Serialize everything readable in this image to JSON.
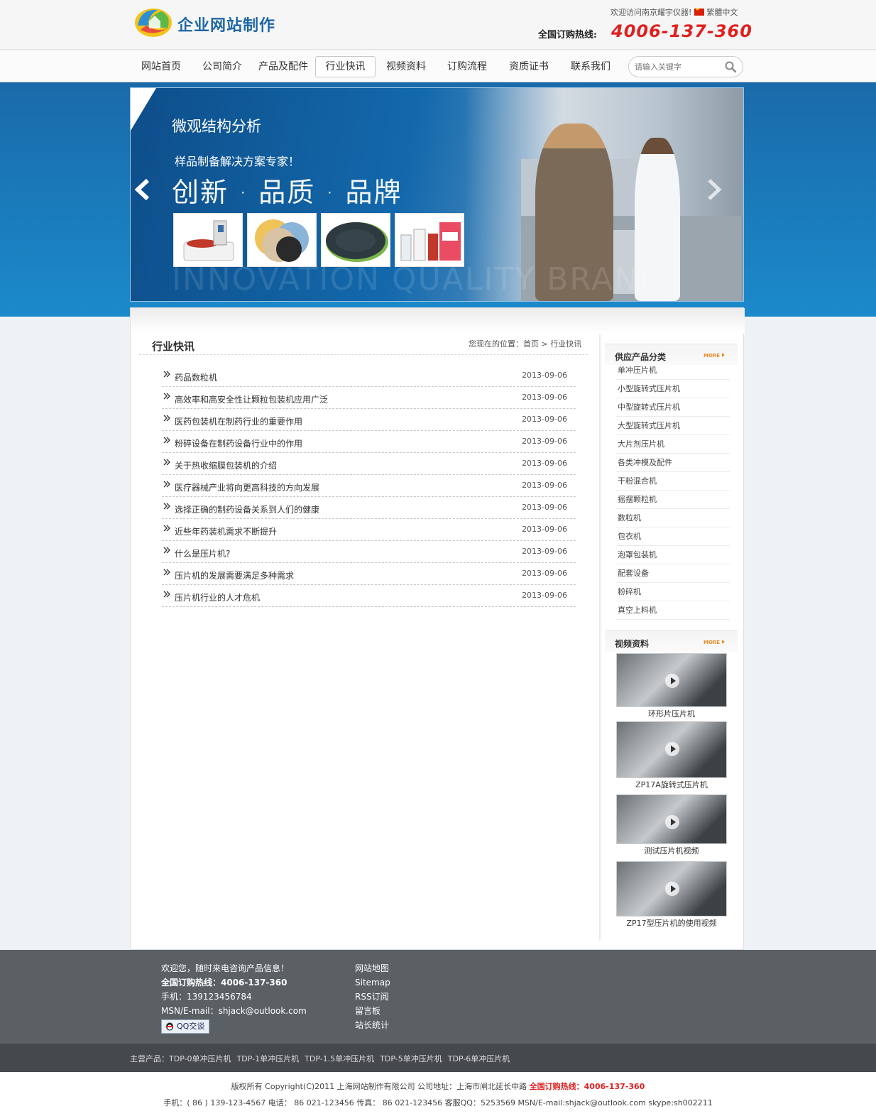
{
  "header": {
    "logo_text": "企业网站制作",
    "welcome": "欢迎访问南京耀宇仪器!",
    "language": "繁體中文",
    "hotline_label": "全国订购热线:",
    "hotline_number": "4006-137-360"
  },
  "nav": {
    "items": [
      {
        "label": "网站首页"
      },
      {
        "label": "公司简介"
      },
      {
        "label": "产品及配件"
      },
      {
        "label": "行业快讯",
        "active": true
      },
      {
        "label": "视频资料"
      },
      {
        "label": "订购流程"
      },
      {
        "label": "资质证书"
      },
      {
        "label": "联系我们"
      }
    ],
    "search_placeholder": "请输入关键字"
  },
  "banner": {
    "title": "微观结构分析",
    "subtitle": "样品制备解决方案专家！",
    "slogan": "创新 · 品质 · 品牌",
    "watermark": "INNOVATION QUALITY BRAND"
  },
  "main": {
    "section_title": "行业快讯",
    "breadcrumb_prefix": "您现在的位置：",
    "breadcrumb_home": "首页",
    "breadcrumb_sep": ">",
    "breadcrumb_current": "行业快讯",
    "news": [
      {
        "title": "药品数粒机",
        "date": "2013-09-06"
      },
      {
        "title": "高效率和高安全性让颗粒包装机应用广泛",
        "date": "2013-09-06"
      },
      {
        "title": "医药包装机在制药行业的重要作用",
        "date": "2013-09-06"
      },
      {
        "title": "粉碎设备在制药设备行业中的作用",
        "date": "2013-09-06"
      },
      {
        "title": "关于热收缩膜包装机的介绍",
        "date": "2013-09-06"
      },
      {
        "title": "医疗器械产业将向更高科技的方向发展",
        "date": "2013-09-06"
      },
      {
        "title": "选择正确的制药设备关系到人们的健康",
        "date": "2013-09-06"
      },
      {
        "title": "近些年药装机需求不断提升",
        "date": "2013-09-06"
      },
      {
        "title": "什么是压片机?",
        "date": "2013-09-06"
      },
      {
        "title": "压片机的发展需要满足多种需求",
        "date": "2013-09-06"
      },
      {
        "title": "压片机行业的人才危机",
        "date": "2013-09-06"
      }
    ]
  },
  "sidebar": {
    "categories_title": "供应产品分类",
    "more_label": "MORE",
    "categories": [
      "单冲压片机",
      "小型旋转式压片机",
      "中型旋转式压片机",
      "大型旋转式压片机",
      "大片剂压片机",
      "各类冲模及配件",
      "干粉混合机",
      "摇摆颗粒机",
      "数粒机",
      "包衣机",
      "泡罩包装机",
      "配套设备",
      "粉碎机",
      "真空上料机"
    ],
    "videos_title": "视频资料",
    "videos": [
      {
        "caption": "环形片压片机"
      },
      {
        "caption": "ZP17A旋转式压片机"
      },
      {
        "caption": "测试压片机视频"
      },
      {
        "caption": "ZP17型压片机的使用视频"
      }
    ]
  },
  "footer": {
    "welcome": "欢迎您，随时来电咨询产品信息！",
    "hotline": "全国订购热线：4006-137-360",
    "mobile": "手机：139123456784",
    "email": "MSN/E-mail：shjack@outlook.com",
    "qq_label": "QQ交谈",
    "links": [
      "网站地图",
      "Sitemap",
      "RSS订阅",
      "留言板",
      "站长统计"
    ],
    "products_label": "主营产品：",
    "products": [
      "TDP-0单冲压片机",
      "TDP-1单冲压片机",
      "TDP-1.5单冲压片机",
      "TDP-5单冲压片机",
      "TDP-6单冲压片机"
    ],
    "copyright": "版权所有 Copyright(C)2011 上海网站制作有限公司 公司地址：上海市闸北延长中路",
    "copyright_hotline": "全国订购热线：4006-137-360",
    "contact": "手机：( 86 ) 139-123-4567 电话： 86 021-123456 传真： 86 021-123456 客服QQ：5253569 MSN/E-mail:shjack@outlook.com skype:sh002211"
  },
  "colors": {
    "accent_red": "#e02020",
    "banner_blue": "#1a6aa9",
    "footer_gray": "#5b6065"
  }
}
